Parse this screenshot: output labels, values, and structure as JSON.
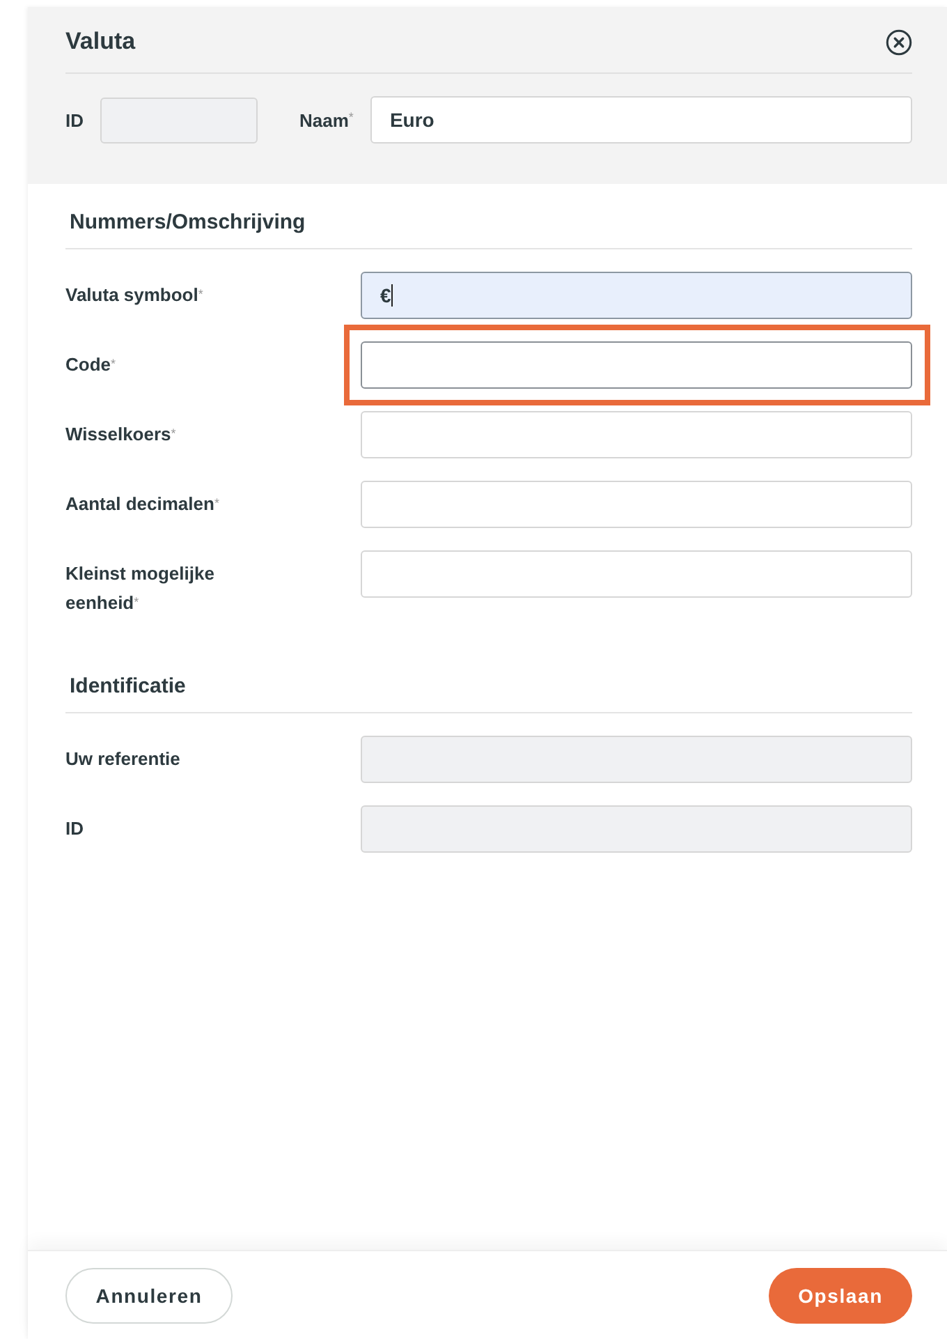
{
  "header": {
    "title": "Valuta",
    "id_label": "ID",
    "name_label": "Naam",
    "name_required_mark": "*",
    "name_value": "Euro"
  },
  "sections": [
    {
      "title": "Nummers/Omschrijving",
      "fields": [
        {
          "label": "Valuta symbool",
          "required_mark": "*",
          "value": "€",
          "focused": true,
          "highlighted": false,
          "disabled": false
        },
        {
          "label": "Code",
          "required_mark": "*",
          "focused": false,
          "highlighted": true,
          "disabled": false
        },
        {
          "label": "Wisselkoers",
          "required_mark": "*",
          "focused": false,
          "highlighted": false,
          "disabled": false
        },
        {
          "label": "Aantal decimalen",
          "required_mark": "*",
          "focused": false,
          "highlighted": false,
          "disabled": false
        },
        {
          "label": "Kleinst mogelijke eenheid",
          "required_mark": "*",
          "focused": false,
          "highlighted": false,
          "disabled": false
        }
      ]
    },
    {
      "title": "Identificatie",
      "fields": [
        {
          "label": "Uw referentie",
          "focused": false,
          "highlighted": false,
          "disabled": true
        },
        {
          "label": "ID",
          "focused": false,
          "highlighted": false,
          "disabled": true
        }
      ]
    }
  ],
  "footer": {
    "cancel": "Annuleren",
    "save": "Opslaan"
  }
}
